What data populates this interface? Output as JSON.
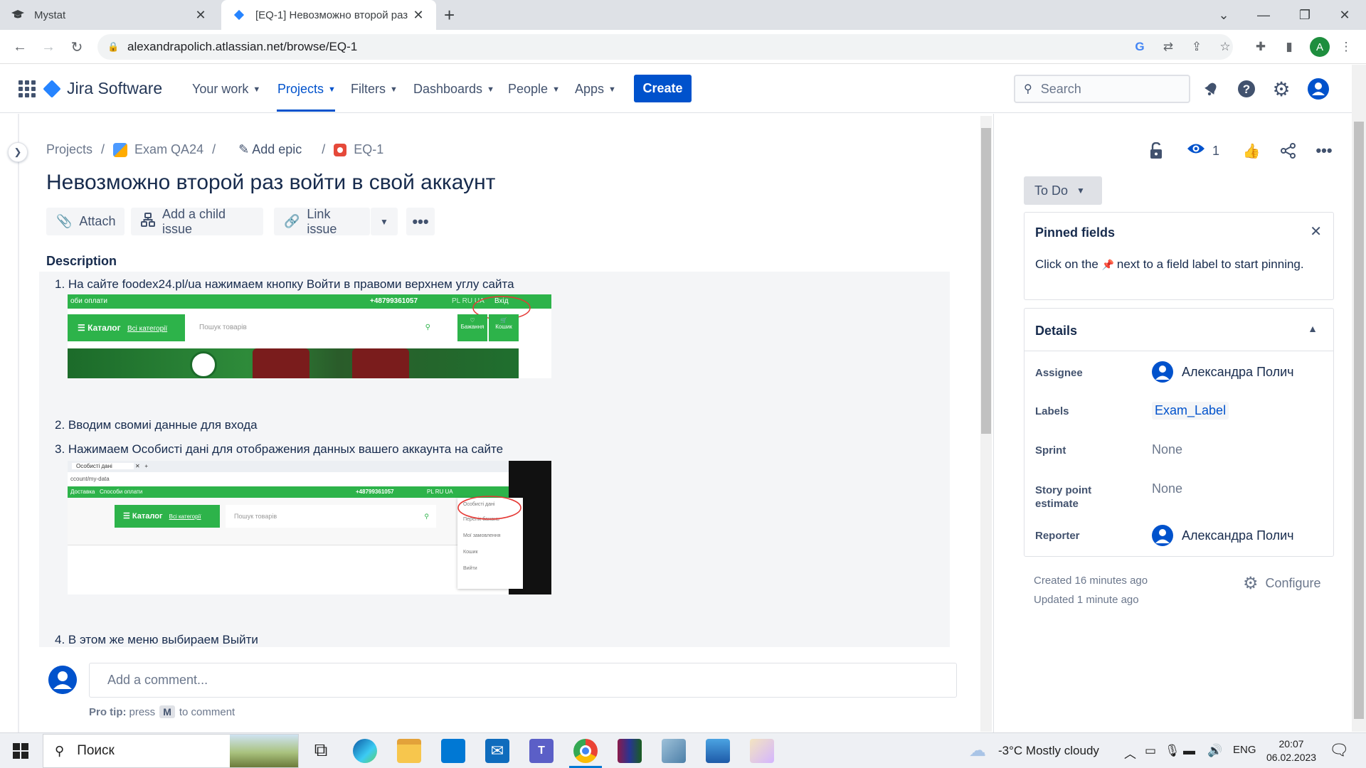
{
  "browser": {
    "tabs": [
      {
        "title": "Mystat",
        "active": false
      },
      {
        "title": "[EQ-1] Невозможно второй раз",
        "active": true
      }
    ],
    "url": "alexandrapolich.atlassian.net/browse/EQ-1",
    "profile_initial": "A"
  },
  "jira": {
    "product": "Jira Software",
    "nav": [
      "Your work",
      "Projects",
      "Filters",
      "Dashboards",
      "People",
      "Apps"
    ],
    "selected_nav": "Projects",
    "create_label": "Create",
    "search_placeholder": "Search"
  },
  "breadcrumb": {
    "projects": "Projects",
    "project": "Exam QA24",
    "add_epic": "Add epic",
    "issue_key": "EQ-1"
  },
  "issue": {
    "title": "Невозможно второй раз войти в свой аккаунт",
    "actions": {
      "attach": "Attach",
      "child": "Add a child issue",
      "link": "Link issue"
    },
    "description_label": "Description",
    "steps": [
      "1. На сайте foodex24.pl/ua нажимаем кнопку Войти в правоми верхнем углу сайта",
      "2. Вводим свомиі данные для входа",
      "3. Нажимаем Особисті дані для отображения данных вашего аккаунта на сайте",
      "4. В этом же меню выбираем Выйти"
    ],
    "screenshot1": {
      "top_left": "оби оплати",
      "phone": "+48799361057",
      "langs": "PL  RU  UA",
      "login": "Вхід",
      "catalog": "Каталог",
      "all_categories": "Всі категорії",
      "search": "Пошук товарів",
      "wishlist": "Бажання",
      "cart": "Кошик"
    },
    "screenshot2": {
      "tab": "Особисті дані",
      "url": "ccount/my-data",
      "delivery": "Доставка",
      "payment": "Способи оплати",
      "phone": "+48799361057",
      "langs": "PL  RU  UA",
      "catalog": "Каталог",
      "all_categories": "Всі категорії",
      "search": "Пошук товарів",
      "menu": [
        "Особисті дані",
        "Перелік бажань",
        "Мої замовлення",
        "Кошик",
        "Вийти"
      ]
    },
    "comment_placeholder": "Add a comment...",
    "protip_bold": "Pro tip:",
    "protip_press": "press",
    "protip_key": "M",
    "protip_tail": "to comment"
  },
  "sidebar": {
    "watch_count": "1",
    "status": "To Do",
    "pinned": {
      "title": "Pinned fields",
      "text_before": "Click on the",
      "text_after": "next to a field label to start pinning."
    },
    "details": {
      "title": "Details",
      "assignee_label": "Assignee",
      "assignee": "Александра Полич",
      "labels_label": "Labels",
      "label_value": "Exam_Label",
      "sprint_label": "Sprint",
      "sprint": "None",
      "story_label": "Story point estimate",
      "story": "None",
      "reporter_label": "Reporter",
      "reporter": "Александра Полич"
    },
    "created": "Created 16 minutes ago",
    "updated": "Updated 1 minute ago",
    "configure": "Configure"
  },
  "taskbar": {
    "search": "Поиск",
    "weather": "-3°C  Mostly cloudy",
    "lang": "ENG",
    "time": "20:07",
    "date": "06.02.2023"
  },
  "colors": {
    "jira_blue": "#0052cc",
    "site_green": "#2db34a"
  }
}
